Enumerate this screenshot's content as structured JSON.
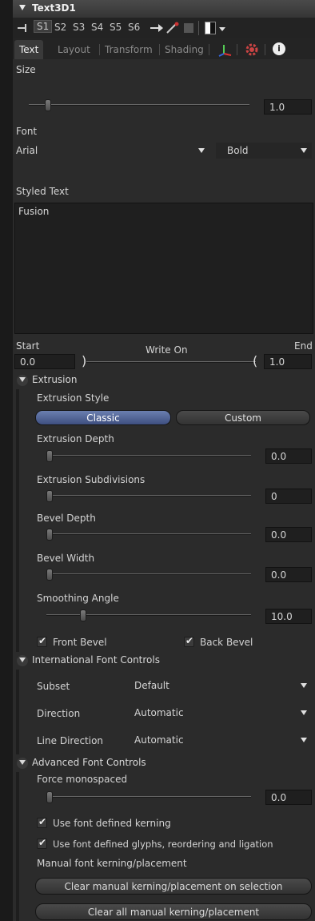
{
  "header": {
    "title": "Text3D1"
  },
  "toolbar": {
    "slots": [
      "S1",
      "S2",
      "S3",
      "S4",
      "S5",
      "S6"
    ],
    "selected_slot": "S1"
  },
  "tabs": [
    "Text",
    "Layout",
    "Transform",
    "Shading"
  ],
  "text_tab": {
    "size": {
      "label": "Size",
      "value": "1.0",
      "level": 0.1
    },
    "font": {
      "label": "Font",
      "family": "Arial",
      "style": "Bold"
    },
    "styled_text": {
      "label": "Styled Text",
      "value": "Fusion"
    },
    "write_on": {
      "start_label": "Start",
      "center_label": "Write On",
      "end_label": "End",
      "start_value": "0.0",
      "end_value": "1.0"
    }
  },
  "extrusion": {
    "label": "Extrusion",
    "style_label": "Extrusion Style",
    "style_options": [
      "Classic",
      "Custom"
    ],
    "style_selected": "Classic",
    "depth": {
      "label": "Extrusion Depth",
      "value": "0.0"
    },
    "subdivisions": {
      "label": "Extrusion Subdivisions",
      "value": "0"
    },
    "bevel_depth": {
      "label": "Bevel Depth",
      "value": "0.0"
    },
    "bevel_width": {
      "label": "Bevel Width",
      "value": "0.0"
    },
    "smoothing_angle": {
      "label": "Smoothing Angle",
      "value": "10.0",
      "level": 0.2
    },
    "front_bevel": {
      "label": "Front Bevel",
      "checked": true
    },
    "back_bevel": {
      "label": "Back Bevel",
      "checked": true
    }
  },
  "international": {
    "label": "International Font Controls",
    "subset": {
      "label": "Subset",
      "value": "Default"
    },
    "direction": {
      "label": "Direction",
      "value": "Automatic"
    },
    "line_direction": {
      "label": "Line Direction",
      "value": "Automatic"
    }
  },
  "advanced": {
    "label": "Advanced Font Controls",
    "force_mono": {
      "label": "Force monospaced",
      "value": "0.0"
    },
    "kerning": {
      "label": "Use font defined kerning",
      "checked": true
    },
    "glyphs": {
      "label": "Use font defined glyphs, reordering and ligation",
      "checked": true
    },
    "manual_label": "Manual font kerning/placement",
    "clear_selection": "Clear manual kerning/placement on selection",
    "clear_all": "Clear all manual kerning/placement"
  },
  "colors": {
    "accent": "#4f63a0",
    "header": "#d0a040",
    "panel": "#2b2b2b",
    "field": "#1f1f1f"
  }
}
